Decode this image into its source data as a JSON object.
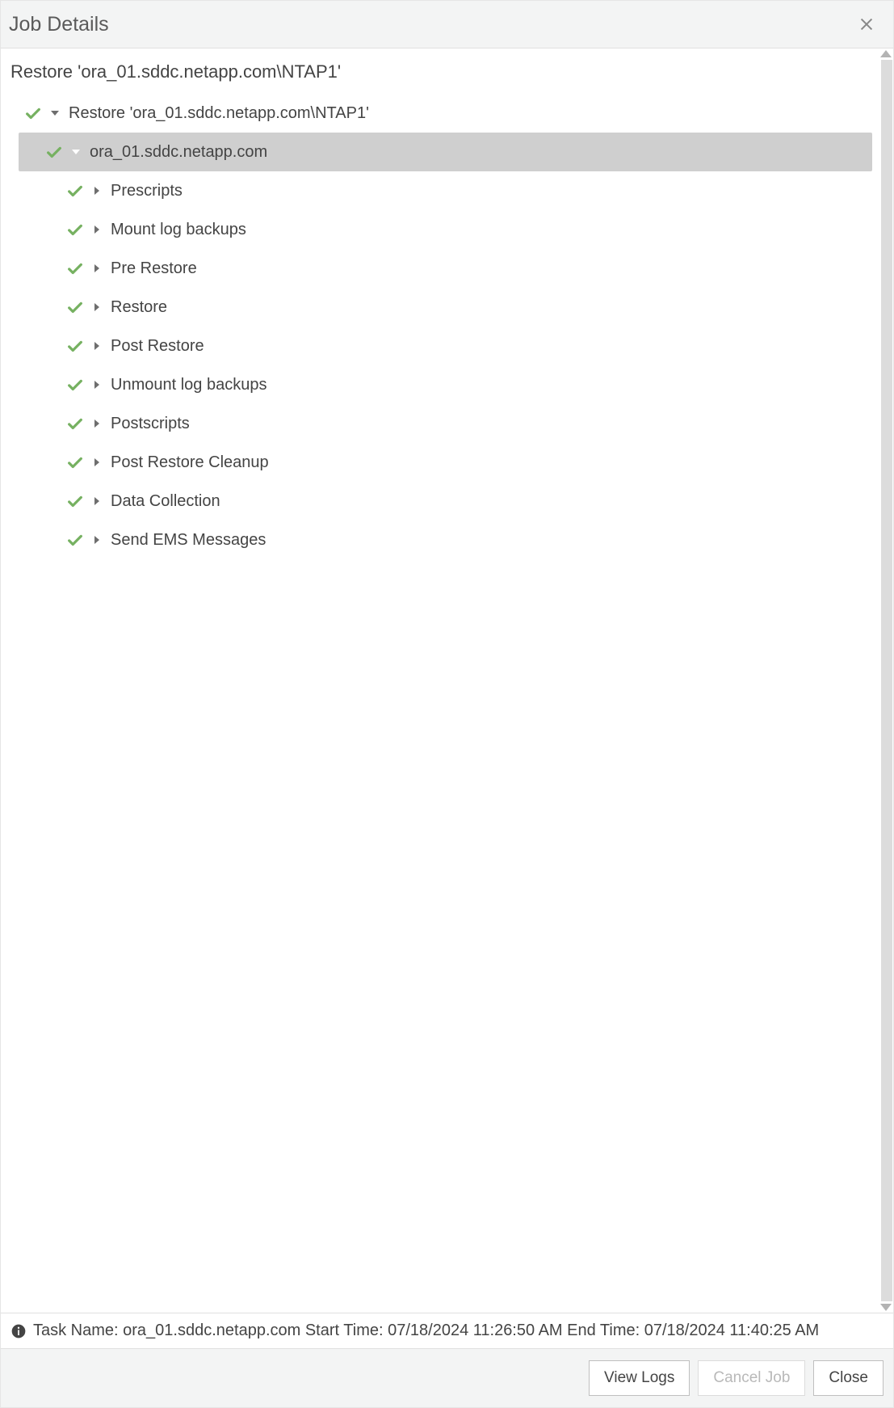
{
  "modal": {
    "title": "Job Details"
  },
  "job": {
    "title": "Restore 'ora_01.sddc.netapp.com\\NTAP1'"
  },
  "tree": {
    "root": {
      "label": "Restore 'ora_01.sddc.netapp.com\\NTAP1'",
      "host": {
        "label": "ora_01.sddc.netapp.com",
        "steps": [
          {
            "label": "Prescripts"
          },
          {
            "label": "Mount log backups"
          },
          {
            "label": "Pre Restore"
          },
          {
            "label": "Restore"
          },
          {
            "label": "Post Restore"
          },
          {
            "label": "Unmount log backups"
          },
          {
            "label": "Postscripts"
          },
          {
            "label": "Post Restore Cleanup"
          },
          {
            "label": "Data Collection"
          },
          {
            "label": "Send EMS Messages"
          }
        ]
      }
    }
  },
  "taskbar": {
    "text": "Task Name: ora_01.sddc.netapp.com Start Time: 07/18/2024 11:26:50 AM End Time: 07/18/2024 11:40:25 AM"
  },
  "footer": {
    "view_logs": "View Logs",
    "cancel_job": "Cancel Job",
    "close": "Close"
  }
}
